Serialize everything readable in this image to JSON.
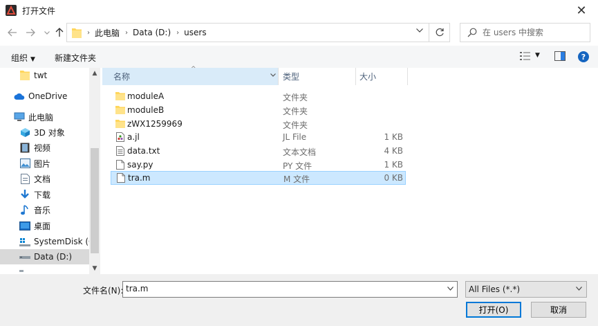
{
  "window": {
    "title": "打开文件",
    "close_glyph": "✕"
  },
  "address": {
    "crumbs": [
      "此电脑",
      "Data (D:)",
      "users"
    ],
    "search_placeholder": "在 users 中搜索"
  },
  "toolbar": {
    "organize": "组织",
    "new_folder": "新建文件夹"
  },
  "nav": {
    "items": [
      {
        "label": "twt",
        "icon": "folder-icon"
      },
      {
        "label": "OneDrive",
        "icon": "cloud-icon"
      },
      {
        "label": "此电脑",
        "icon": "computer-icon"
      },
      {
        "label": "3D 对象",
        "icon": "cube-icon"
      },
      {
        "label": "视频",
        "icon": "video-icon"
      },
      {
        "label": "图片",
        "icon": "picture-icon"
      },
      {
        "label": "文档",
        "icon": "document-icon"
      },
      {
        "label": "下载",
        "icon": "download-icon"
      },
      {
        "label": "音乐",
        "icon": "music-icon"
      },
      {
        "label": "桌面",
        "icon": "desktop-icon"
      },
      {
        "label": "SystemDisk (C:",
        "icon": "system-drive-icon"
      },
      {
        "label": "Data (D:)",
        "icon": "drive-icon",
        "selected": true
      }
    ]
  },
  "columns": {
    "name": "名称",
    "type": "类型",
    "size": "大小"
  },
  "files": [
    {
      "name": "moduleA",
      "type": "文件夹",
      "size": "",
      "icon": "folder-icon"
    },
    {
      "name": "moduleB",
      "type": "文件夹",
      "size": "",
      "icon": "folder-icon"
    },
    {
      "name": "zWX1259969",
      "type": "文件夹",
      "size": "",
      "icon": "folder-icon"
    },
    {
      "name": "a.jl",
      "type": "JL File",
      "size": "1 KB",
      "icon": "julia-file-icon"
    },
    {
      "name": "data.txt",
      "type": "文本文档",
      "size": "4 KB",
      "icon": "text-file-icon"
    },
    {
      "name": "say.py",
      "type": "PY 文件",
      "size": "1 KB",
      "icon": "blank-file-icon"
    },
    {
      "name": "tra.m",
      "type": "M 文件",
      "size": "0 KB",
      "icon": "blank-file-icon",
      "selected": true
    }
  ],
  "bottom": {
    "filename_label": "文件名(N):",
    "filename_value": "tra.m",
    "filter": "All Files (*.*)",
    "open": "打开(O)",
    "cancel": "取消"
  },
  "colors": {
    "accent": "#0078d7",
    "selected_row": "#cce8ff",
    "folder": "#ffd65c"
  }
}
